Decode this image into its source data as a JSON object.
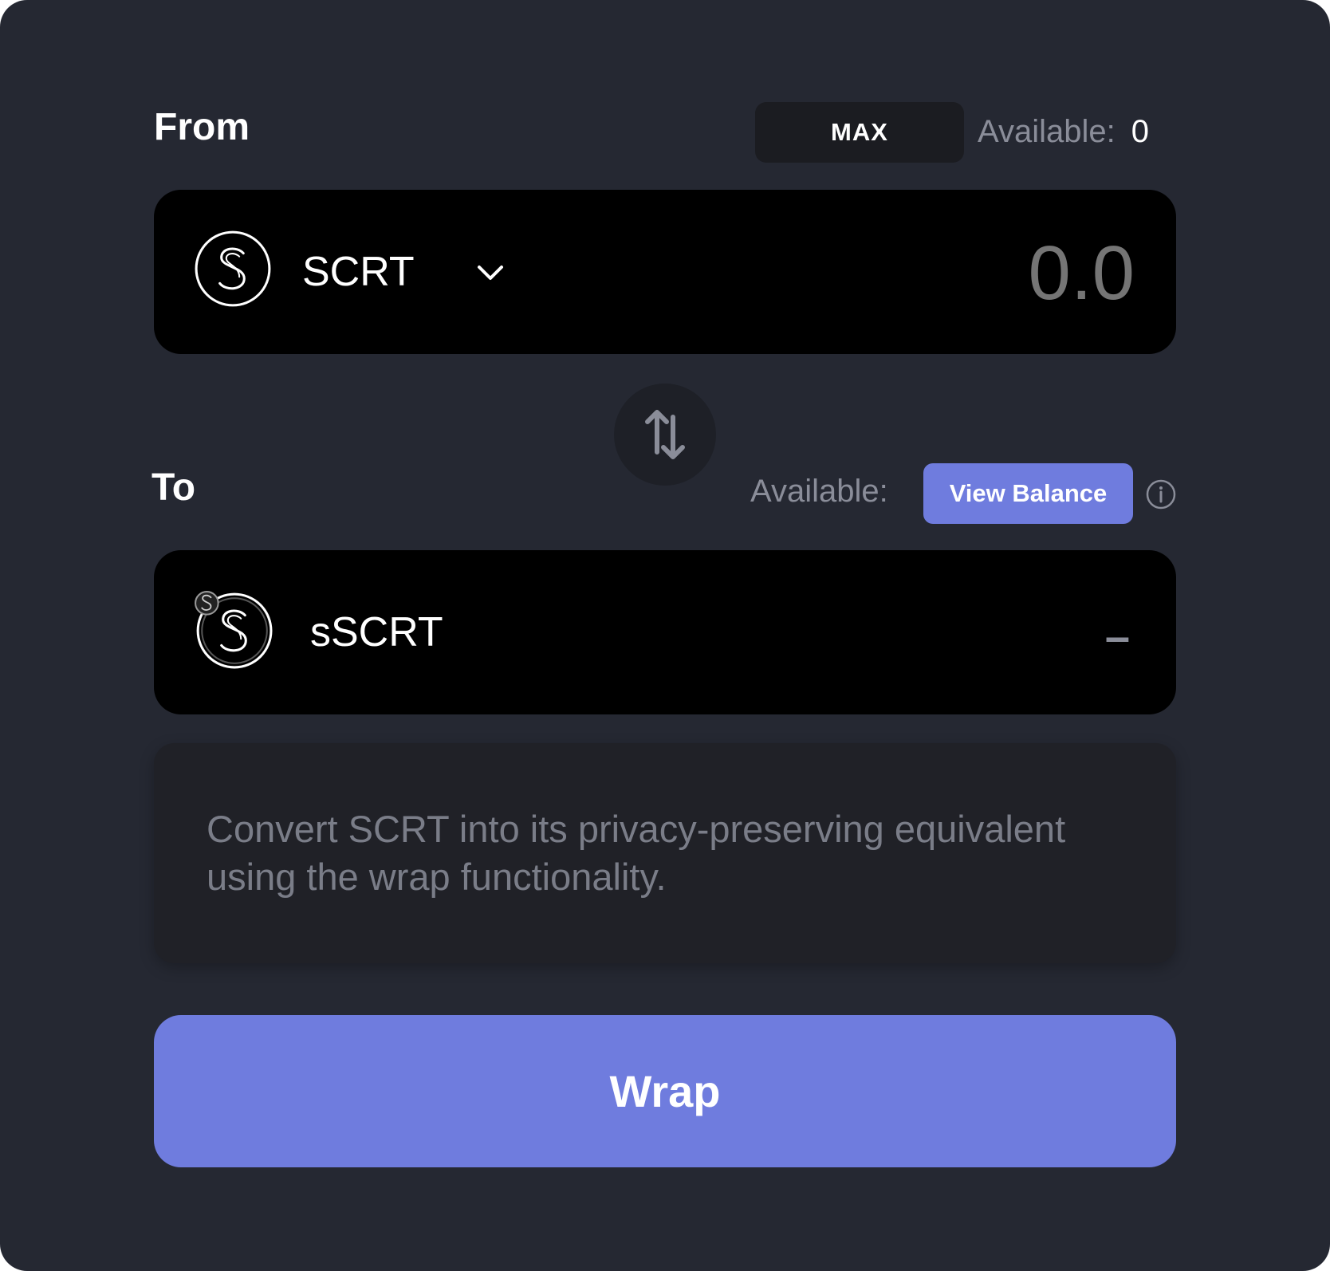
{
  "from": {
    "label": "From",
    "max_label": "MAX",
    "available_label": "Available:",
    "available_value": "0",
    "token": {
      "name": "SCRT",
      "icon": "scrt-logo-icon"
    },
    "amount_placeholder": "0.0"
  },
  "swap": {
    "icon": "swap-arrows-icon"
  },
  "to": {
    "label": "To",
    "available_label": "Available:",
    "view_balance_label": "View Balance",
    "info_icon": "info-icon",
    "token": {
      "name": "sSCRT",
      "icon": "sscrt-logo-icon"
    },
    "amount_value": "–"
  },
  "description": "Convert SCRT into its privacy-preserving equivalent using the wrap functionality.",
  "action": {
    "wrap_label": "Wrap"
  },
  "colors": {
    "panel_bg": "#252832",
    "box_bg": "#000000",
    "accent": "#6f7cde",
    "muted_text": "#8a8d99"
  }
}
